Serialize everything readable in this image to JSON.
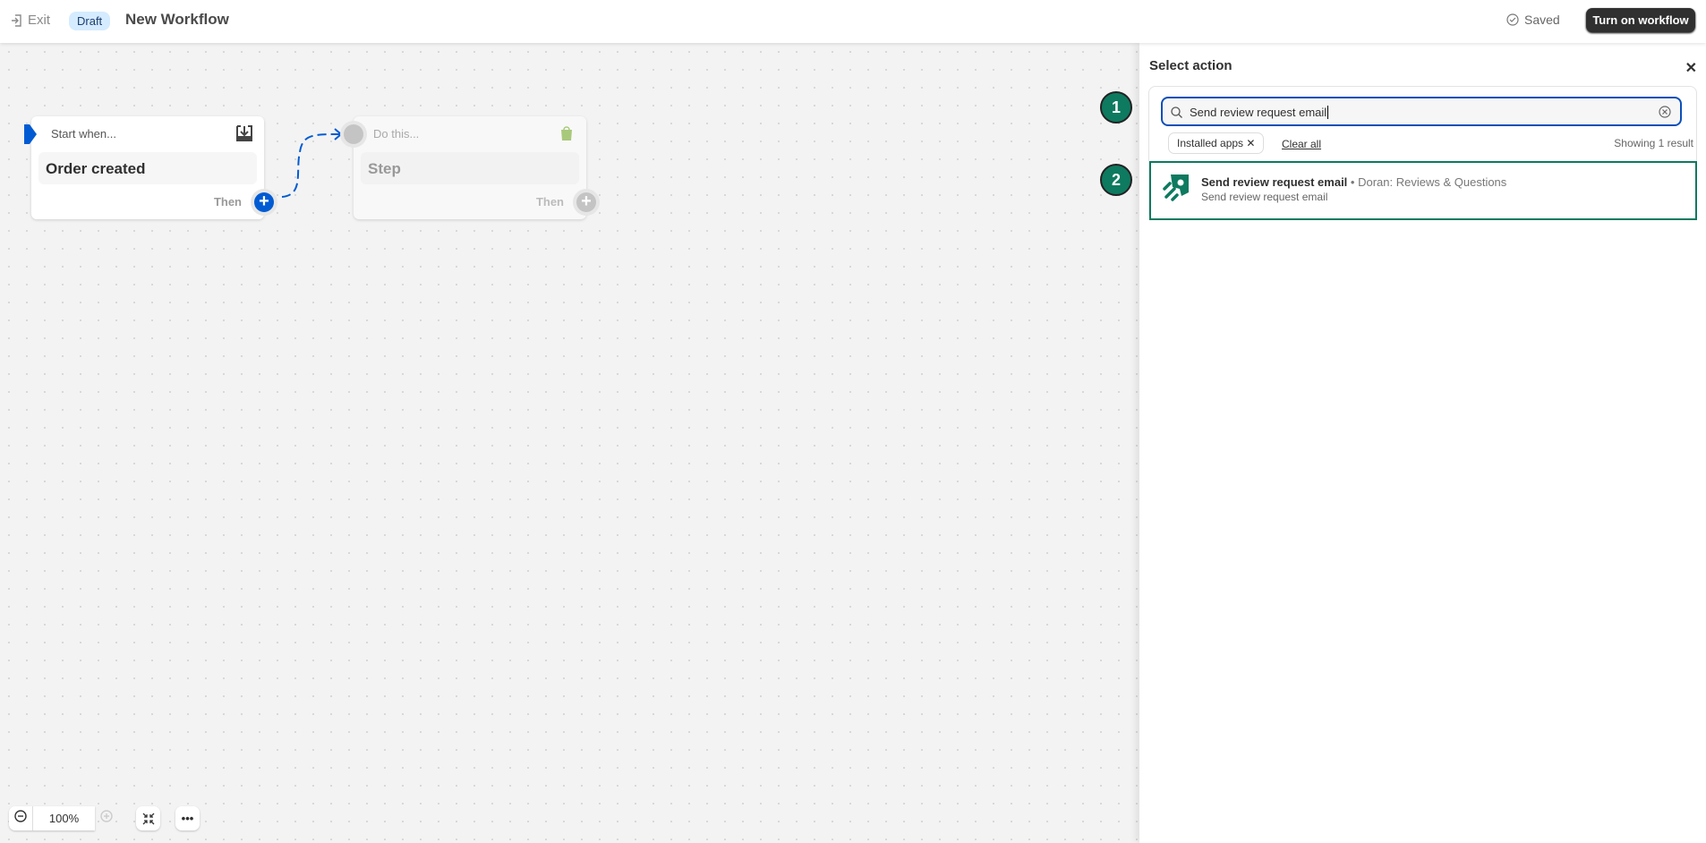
{
  "header": {
    "exit_label": "Exit",
    "status_badge": "Draft",
    "title": "New Workflow",
    "saved_label": "Saved",
    "turn_on_label": "Turn on workflow"
  },
  "canvas": {
    "trigger_card": {
      "header": "Start when...",
      "title": "Order created",
      "then_label": "Then",
      "icon": "download-icon"
    },
    "step_card": {
      "header": "Do this...",
      "title": "Step",
      "then_label": "Then",
      "icon": "shopify-bag-icon"
    },
    "zoom": {
      "level": "100%"
    }
  },
  "panel": {
    "title": "Select action",
    "search": {
      "value": "Send review request email",
      "placeholder": ""
    },
    "filter_chip": "Installed apps",
    "clear_all": "Clear all",
    "result_count": "Showing 1 result",
    "results": [
      {
        "name": "Send review request email",
        "app": "Doran: Reviews & Questions",
        "description": "Send review request email",
        "separator": "•"
      }
    ]
  },
  "annotations": [
    "1",
    "2"
  ],
  "colors": {
    "accent": "#005bd3",
    "highlight": "#0e7a5f",
    "primary_button": "#303030"
  }
}
